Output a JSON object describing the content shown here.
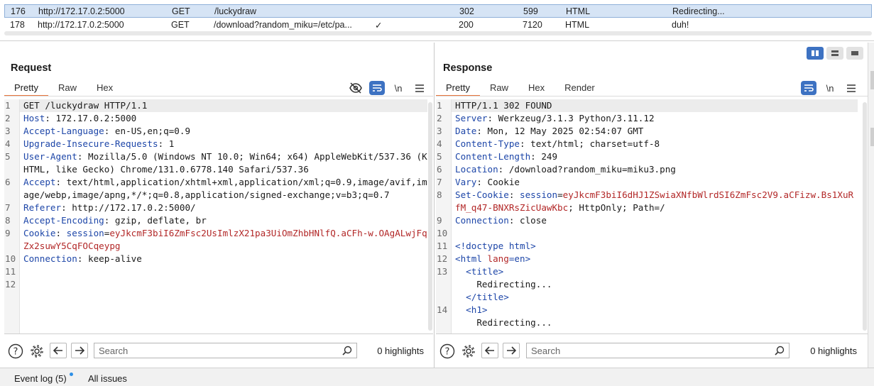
{
  "history": {
    "rows": [
      {
        "id": "176",
        "host": "http://172.17.0.2:5000",
        "method": "GET",
        "url": "/luckydraw",
        "edited": "",
        "status": "302",
        "length": "599",
        "mime": "HTML",
        "title": "Redirecting...",
        "selected": true
      },
      {
        "id": "178",
        "host": "http://172.17.0.2:5000",
        "method": "GET",
        "url": "/download?random_miku=/etc/pa...",
        "edited": "✓",
        "status": "200",
        "length": "7120",
        "mime": "HTML",
        "title": "duh!",
        "selected": false
      }
    ]
  },
  "request": {
    "title": "Request",
    "tabs": [
      "Pretty",
      "Raw",
      "Hex"
    ],
    "active_tab": "Pretty",
    "newline_label": "\\n",
    "lines": [
      {
        "n": "1",
        "parts": [
          {
            "t": "GET /luckydraw HTTP/1.1",
            "c": ""
          }
        ]
      },
      {
        "n": "2",
        "parts": [
          {
            "t": "Host",
            "c": "hk"
          },
          {
            "t": ": 172.17.0.2:5000",
            "c": ""
          }
        ]
      },
      {
        "n": "3",
        "parts": [
          {
            "t": "Accept-Language",
            "c": "hk"
          },
          {
            "t": ": en-US,en;q=0.9",
            "c": ""
          }
        ]
      },
      {
        "n": "4",
        "parts": [
          {
            "t": "Upgrade-Insecure-Requests",
            "c": "hk"
          },
          {
            "t": ": 1",
            "c": ""
          }
        ]
      },
      {
        "n": "5",
        "parts": [
          {
            "t": "User-Agent",
            "c": "hk"
          },
          {
            "t": ": Mozilla/5.0 (Windows NT 10.0; Win64; x64) AppleWebKit/537.36 (KHTML, like Gecko) Chrome/131.0.6778.140 Safari/537.36",
            "c": ""
          }
        ]
      },
      {
        "n": "6",
        "parts": [
          {
            "t": "Accept",
            "c": "hk"
          },
          {
            "t": ": text/html,application/xhtml+xml,application/xml;q=0.9,image/avif,image/webp,image/apng,*/*;q=0.8,application/signed-exchange;v=b3;q=0.7",
            "c": ""
          }
        ]
      },
      {
        "n": "7",
        "parts": [
          {
            "t": "Referer",
            "c": "hk"
          },
          {
            "t": ": http://172.17.0.2:5000/",
            "c": ""
          }
        ]
      },
      {
        "n": "8",
        "parts": [
          {
            "t": "Accept-Encoding",
            "c": "hk"
          },
          {
            "t": ": gzip, deflate, br",
            "c": ""
          }
        ]
      },
      {
        "n": "9",
        "parts": [
          {
            "t": "Cookie",
            "c": "hk"
          },
          {
            "t": ": ",
            "c": ""
          },
          {
            "t": "session",
            "c": "hk"
          },
          {
            "t": "=",
            "c": ""
          },
          {
            "t": "eyJkcmF3biI6ZmFsc2UsImlzX21pa3UiOmZhbHNlfQ.aCFh-w.OAgALwjFqZx2suwY5CqFOCqeypg",
            "c": "cv"
          }
        ]
      },
      {
        "n": "10",
        "parts": [
          {
            "t": "Connection",
            "c": "hk"
          },
          {
            "t": ": keep-alive",
            "c": ""
          }
        ]
      },
      {
        "n": "11",
        "parts": [
          {
            "t": "",
            "c": ""
          }
        ]
      },
      {
        "n": "12",
        "parts": [
          {
            "t": "",
            "c": ""
          }
        ]
      }
    ],
    "search_placeholder": "Search",
    "highlights": "0 highlights"
  },
  "response": {
    "title": "Response",
    "tabs": [
      "Pretty",
      "Raw",
      "Hex",
      "Render"
    ],
    "active_tab": "Pretty",
    "newline_label": "\\n",
    "lines": [
      {
        "n": "1",
        "parts": [
          {
            "t": "HTTP/1.1 302 FOUND",
            "c": ""
          }
        ]
      },
      {
        "n": "2",
        "parts": [
          {
            "t": "Server",
            "c": "hk"
          },
          {
            "t": ": Werkzeug/3.1.3 Python/3.11.12",
            "c": ""
          }
        ]
      },
      {
        "n": "3",
        "parts": [
          {
            "t": "Date",
            "c": "hk"
          },
          {
            "t": ": Mon, 12 May 2025 02:54:07 GMT",
            "c": ""
          }
        ]
      },
      {
        "n": "4",
        "parts": [
          {
            "t": "Content-Type",
            "c": "hk"
          },
          {
            "t": ": text/html; charset=utf-8",
            "c": ""
          }
        ]
      },
      {
        "n": "5",
        "parts": [
          {
            "t": "Content-Length",
            "c": "hk"
          },
          {
            "t": ": 249",
            "c": ""
          }
        ]
      },
      {
        "n": "6",
        "parts": [
          {
            "t": "Location",
            "c": "hk"
          },
          {
            "t": ": /download?random_miku=miku3.png",
            "c": ""
          }
        ]
      },
      {
        "n": "7",
        "parts": [
          {
            "t": "Vary",
            "c": "hk"
          },
          {
            "t": ": Cookie",
            "c": ""
          }
        ]
      },
      {
        "n": "8",
        "parts": [
          {
            "t": "Set-Cookie",
            "c": "hk"
          },
          {
            "t": ": ",
            "c": ""
          },
          {
            "t": "session",
            "c": "hk"
          },
          {
            "t": "=",
            "c": ""
          },
          {
            "t": "eyJkcmF3biI6dHJ1ZSwiaXNfbWlrdSI6ZmFsc2V9.aCFizw.Bs1XuRfM_q47-BNXRsZicUawKbc",
            "c": "cv"
          },
          {
            "t": "; HttpOnly; Path=/",
            "c": ""
          }
        ]
      },
      {
        "n": "9",
        "parts": [
          {
            "t": "Connection",
            "c": "hk"
          },
          {
            "t": ": close",
            "c": ""
          }
        ]
      },
      {
        "n": "10",
        "parts": [
          {
            "t": "",
            "c": ""
          }
        ]
      },
      {
        "n": "11",
        "parts": [
          {
            "t": "<!doctype html>",
            "c": "tg"
          }
        ]
      },
      {
        "n": "12",
        "parts": [
          {
            "t": "<html ",
            "c": "tg"
          },
          {
            "t": "lang",
            "c": "an"
          },
          {
            "t": "=en>",
            "c": "tg"
          }
        ]
      },
      {
        "n": "13",
        "parts": [
          {
            "t": "  <title>",
            "c": "tg"
          },
          {
            "t": "\n    Redirecting...\n  ",
            "c": ""
          },
          {
            "t": "</title>",
            "c": "tg"
          }
        ]
      },
      {
        "n": "14",
        "parts": [
          {
            "t": "  <h1>",
            "c": "tg"
          },
          {
            "t": "\n    Redirecting...",
            "c": ""
          }
        ]
      }
    ],
    "search_placeholder": "Search",
    "highlights": "0 highlights"
  },
  "footer": {
    "event_log": "Event log (5)",
    "all_issues": "All issues"
  },
  "colors": {
    "accent_tab": "#e8743b",
    "toggle_on": "#3d72c2",
    "header_key": "#1d46a8",
    "cookie_value": "#b22727"
  }
}
